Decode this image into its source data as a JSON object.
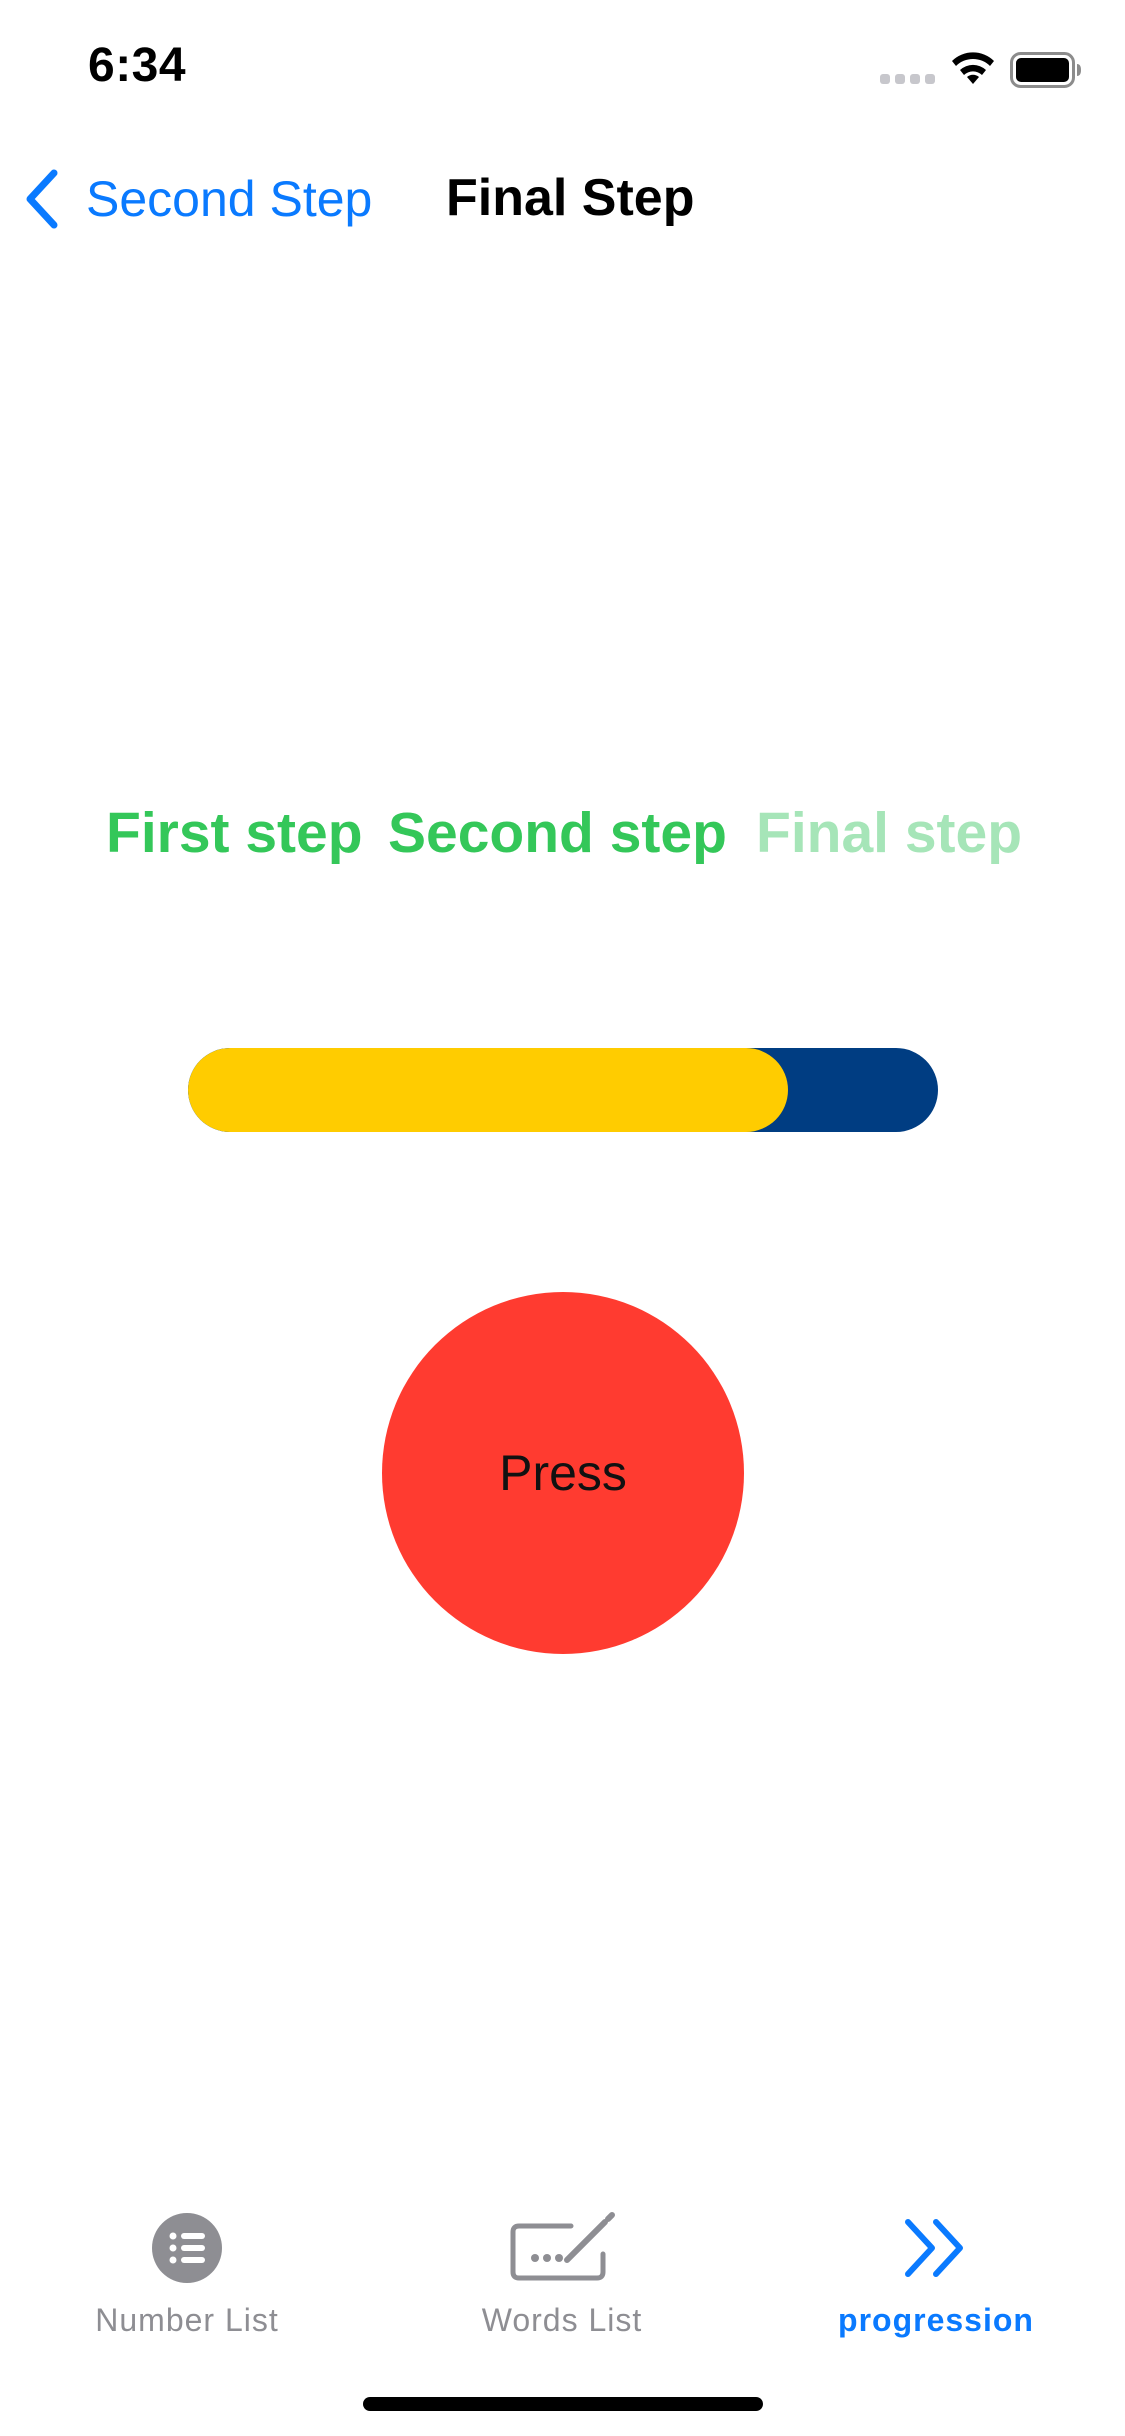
{
  "status_bar": {
    "time": "6:34"
  },
  "nav": {
    "back_label": "Second Step",
    "title": "Final Step"
  },
  "steps": [
    {
      "label": "First step",
      "color": "#34C759",
      "state": "completed"
    },
    {
      "label": "Second step",
      "color": "#34C759",
      "state": "completed"
    },
    {
      "label": "Final step",
      "color": "#A6E5B8",
      "state": "pending"
    }
  ],
  "progress": {
    "value": 0.8,
    "fill_color": "#FFCC00",
    "track_color": "#003D82"
  },
  "press_button": {
    "label": "Press",
    "color": "#FF3B30"
  },
  "tab_bar": {
    "active_color": "#0A7AFF",
    "inactive_color": "#8E8E93",
    "tabs": [
      {
        "label": "Number List",
        "icon": "list-bullet-circle-icon",
        "active": false
      },
      {
        "label": "Words List",
        "icon": "keyboard-pencil-icon",
        "active": false
      },
      {
        "label": "progression",
        "icon": "chevron-forward-double-icon",
        "active": true
      }
    ]
  }
}
